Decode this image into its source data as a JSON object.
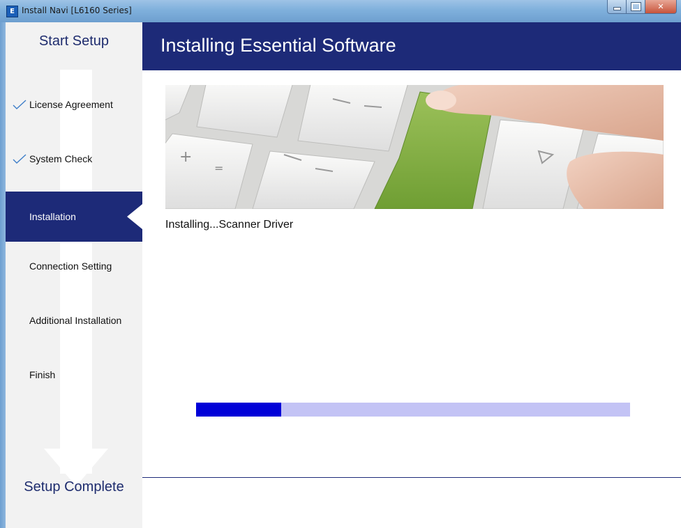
{
  "window": {
    "title": "Install Navi [L6160 Series]",
    "app_icon_letter": "E"
  },
  "sidebar": {
    "start_label": "Start Setup",
    "end_label": "Setup Complete",
    "steps": [
      {
        "label": "License Agreement",
        "completed": true,
        "active": false
      },
      {
        "label": "System Check",
        "completed": true,
        "active": false
      },
      {
        "label": "Installation",
        "completed": false,
        "active": true
      },
      {
        "label": "Connection Setting",
        "completed": false,
        "active": false
      },
      {
        "label": "Additional Installation",
        "completed": false,
        "active": false
      },
      {
        "label": "Finish",
        "completed": false,
        "active": false
      }
    ]
  },
  "header": {
    "title": "Installing Essential Software"
  },
  "main": {
    "status_text": "Installing...Scanner Driver",
    "progress_fraction": 0.196
  },
  "colors": {
    "navy": "#1d2a78",
    "progress_fill": "#0000d8",
    "progress_track": "#c3c3f5",
    "key_green": "#7aab3c",
    "check_blue": "#3f7fc9"
  }
}
